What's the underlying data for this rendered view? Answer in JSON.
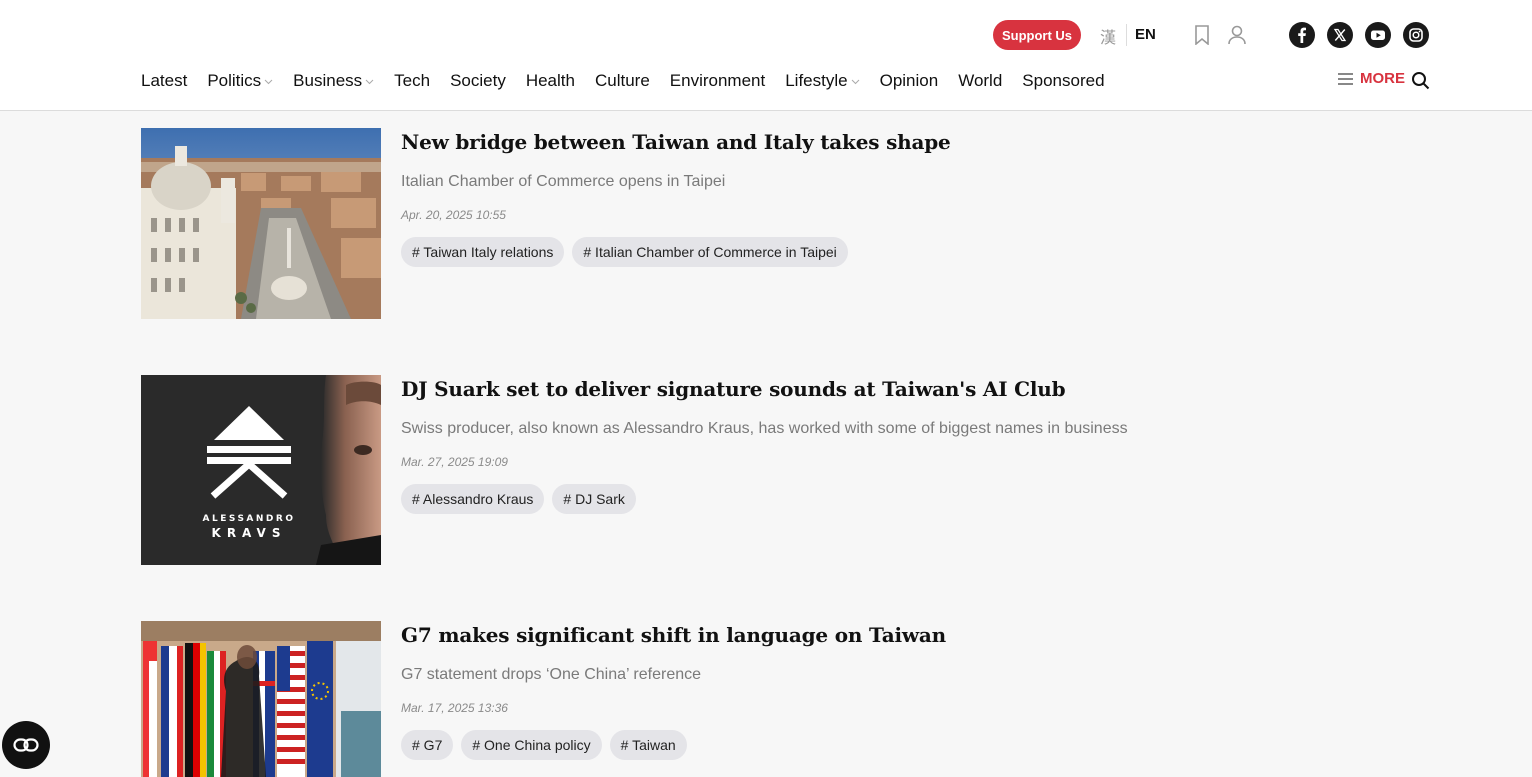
{
  "header": {
    "support_label": "Support Us",
    "lang_zh": "漢",
    "lang_en": "EN",
    "icons": [
      "bookmark-icon",
      "user-icon",
      "facebook-icon",
      "x-icon",
      "youtube-icon",
      "instagram-icon",
      "search-icon",
      "menu-icon"
    ],
    "accent": "#d8333f"
  },
  "nav": {
    "items": [
      {
        "label": "Latest",
        "dropdown": false
      },
      {
        "label": "Politics",
        "dropdown": true
      },
      {
        "label": "Business",
        "dropdown": true
      },
      {
        "label": "Tech",
        "dropdown": false
      },
      {
        "label": "Society",
        "dropdown": false
      },
      {
        "label": "Health",
        "dropdown": false
      },
      {
        "label": "Culture",
        "dropdown": false
      },
      {
        "label": "Environment",
        "dropdown": false
      },
      {
        "label": "Lifestyle",
        "dropdown": true
      },
      {
        "label": "Opinion",
        "dropdown": false
      },
      {
        "label": "World",
        "dropdown": false
      },
      {
        "label": "Sponsored",
        "dropdown": false
      }
    ],
    "more_label": "MORE"
  },
  "articles": [
    {
      "title": "New bridge between Taiwan and Italy takes shape",
      "subtitle": "Italian Chamber of Commerce opens in Taipei",
      "date": "Apr. 20, 2025 10:55",
      "tags": [
        "# Taiwan Italy relations",
        "# Italian Chamber of Commerce in Taipei"
      ]
    },
    {
      "title": "DJ Suark set to deliver signature sounds at Taiwan's AI Club",
      "subtitle": "Swiss producer, also known as Alessandro Kraus, has worked with some of biggest names in business",
      "date": "Mar. 27, 2025 19:09",
      "tags": [
        "# Alessandro Kraus",
        "# DJ Sark"
      ],
      "thumb_text": {
        "line1": "ALESSANDRO",
        "line2": "KRAVS"
      }
    },
    {
      "title": "G7 makes significant shift in language on Taiwan",
      "subtitle": "G7 statement drops ‘One China’ reference",
      "date": "Mar. 17, 2025 13:36",
      "tags": [
        "# G7",
        "# One China policy",
        "# Taiwan"
      ]
    }
  ]
}
